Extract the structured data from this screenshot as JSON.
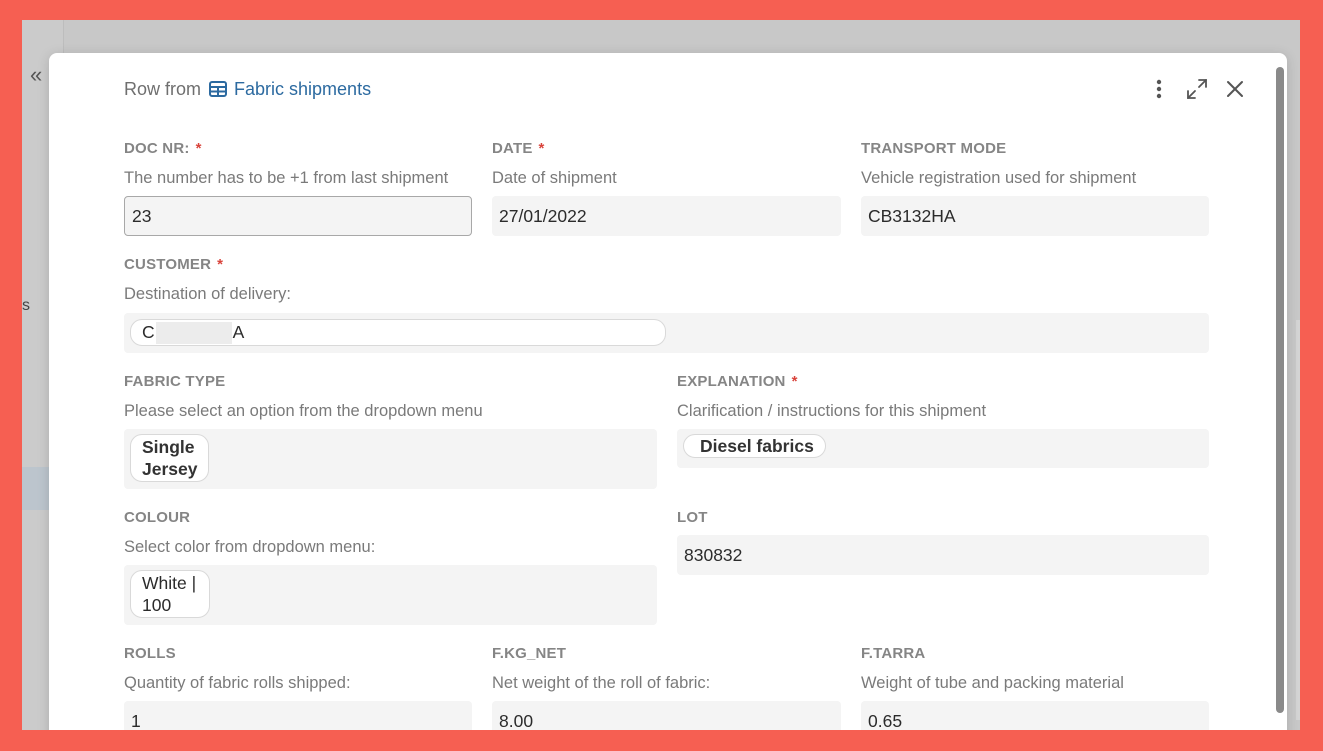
{
  "background": {
    "side_text": "s"
  },
  "modal": {
    "header": {
      "row_from": "Row from",
      "table_name": "Fabric shipments"
    },
    "fields": {
      "doc_nr": {
        "label": "DOC NR:",
        "required": "*",
        "description": "The number has to be +1 from last shipment",
        "value": "23"
      },
      "date": {
        "label": "DATE",
        "required": "*",
        "description": "Date of shipment",
        "value": "27/01/2022"
      },
      "transport_mode": {
        "label": "TRANSPORT MODE",
        "description": "Vehicle registration used for shipment",
        "value": "CB3132HA"
      },
      "customer": {
        "label": "CUSTOMER",
        "required": "*",
        "description": "Destination of delivery:",
        "value_start": "C",
        "value_end": "A"
      },
      "fabric_type": {
        "label": "FABRIC TYPE",
        "description": "Please select an option from the dropdown menu",
        "value_line1": "Single",
        "value_line2": "Jersey"
      },
      "explanation": {
        "label": "EXPLANATION",
        "required": "*",
        "description": "Clarification / instructions for this shipment",
        "value": "Diesel fabrics"
      },
      "colour": {
        "label": "COLOUR",
        "description": "Select color from dropdown menu:",
        "value_line1": "White |",
        "value_line2": "100"
      },
      "lot": {
        "label": "LOT",
        "value": "830832"
      },
      "rolls": {
        "label": "ROLLS",
        "description": "Quantity of fabric rolls shipped:",
        "value": "1"
      },
      "f_kg_net": {
        "label": "F.KG_NET",
        "description": "Net weight of the roll of fabric:",
        "value": "8.00"
      },
      "f_tarra": {
        "label": "F.TARRA",
        "description": "Weight of tube and packing material",
        "value": "0.65"
      }
    }
  },
  "colors": {
    "frame": "#f65f52",
    "link": "#2c6aa0",
    "required": "#d9433b"
  }
}
